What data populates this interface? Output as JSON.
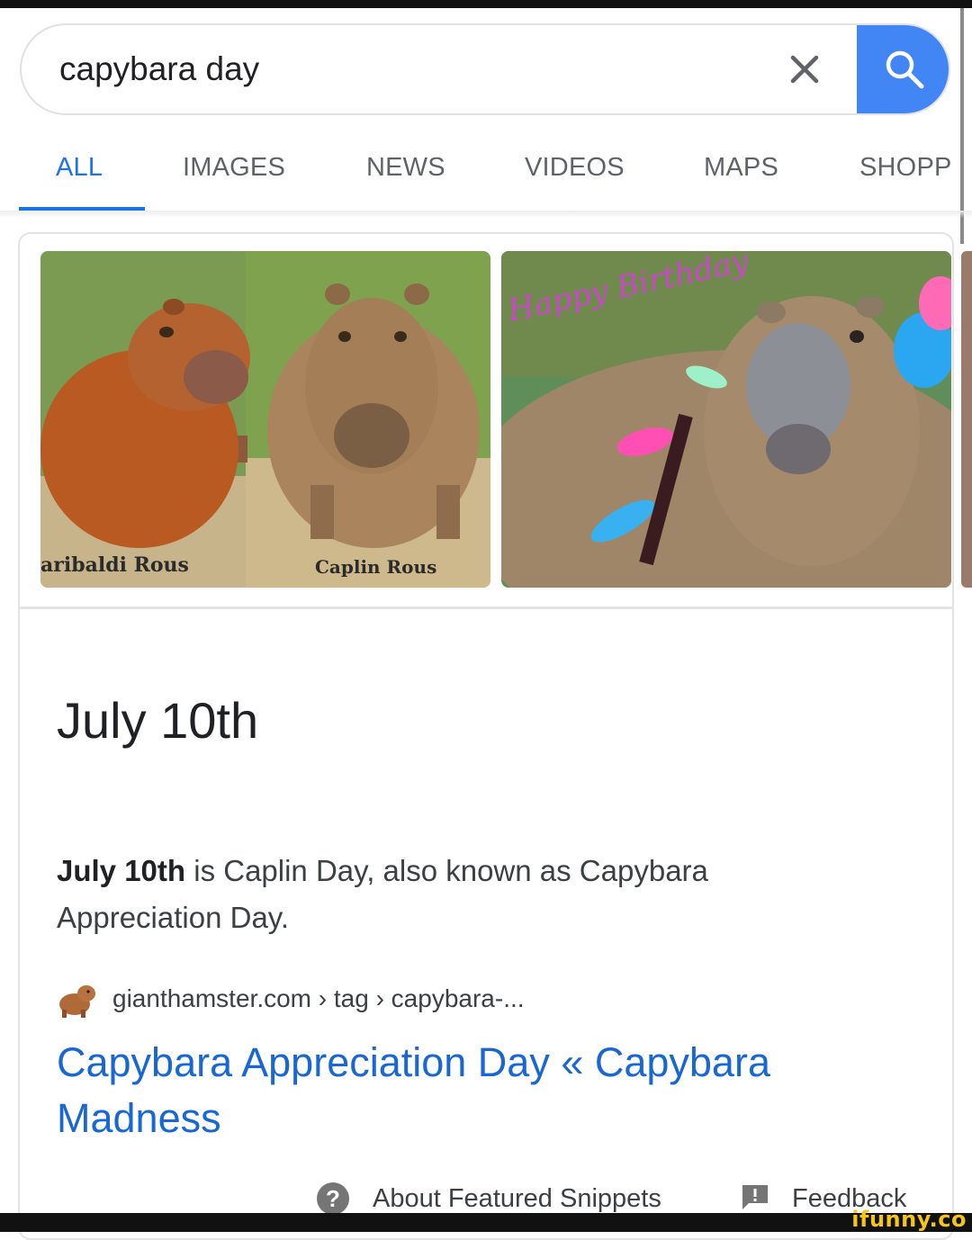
{
  "search": {
    "query": "capybara day"
  },
  "tabs": [
    {
      "label": "ALL",
      "active": true
    },
    {
      "label": "IMAGES"
    },
    {
      "label": "NEWS"
    },
    {
      "label": "VIDEOS"
    },
    {
      "label": "MAPS"
    },
    {
      "label": "SHOPP"
    }
  ],
  "images": {
    "left_captions": [
      "aribaldi Rous",
      "Caplin Rous"
    ],
    "right_banner": "Happy Birthday"
  },
  "answer": {
    "title": "July 10th",
    "snippet_bold": "July 10th",
    "snippet_rest": " is Caplin Day, also known as Capybara Appreciation Day."
  },
  "source": {
    "breadcrumb": "gianthamster.com › tag › capybara-...",
    "link_title": "Capybara Appreciation Day « Capybara Madness"
  },
  "footer": {
    "about_label": "About Featured Snippets",
    "feedback_label": "Feedback"
  },
  "watermark": "ifunny.co",
  "colors": {
    "accent_blue": "#1a73e8",
    "search_button": "#4285f4",
    "link": "#1967d2"
  },
  "icons": [
    "clear-icon",
    "search-icon",
    "capybara-favicon",
    "help-icon",
    "feedback-icon"
  ]
}
